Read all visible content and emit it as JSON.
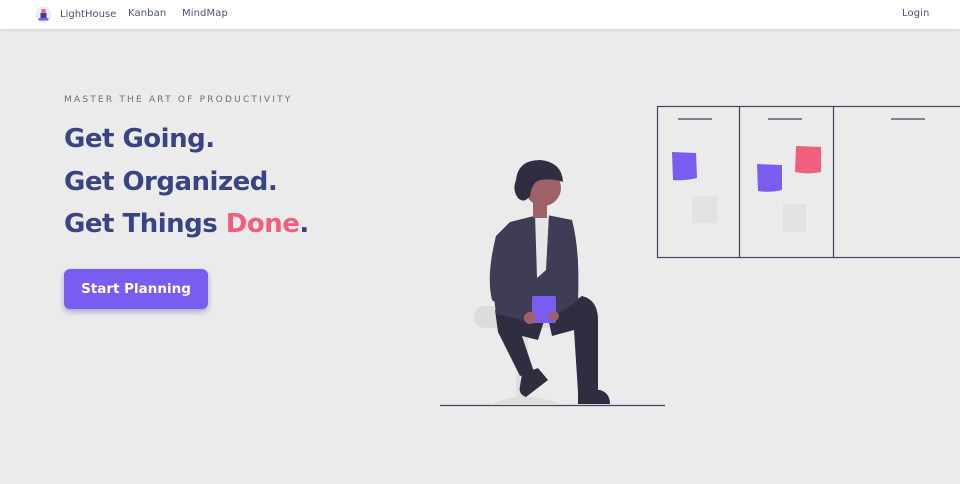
{
  "nav": {
    "brand": "LightHouse",
    "links": [
      "Kanban",
      "MindMap"
    ],
    "login": "Login"
  },
  "hero": {
    "eyebrow": "MASTER THE ART OF PRODUCTIVITY",
    "line1": "Get Going.",
    "line2": "Get Organized.",
    "line3_start": "Get Things ",
    "line3_accent": "Done",
    "line3_end": ".",
    "cta": "Start Planning"
  },
  "colors": {
    "background": "#ebebeb",
    "heading": "#3a4383",
    "accent": "#f0607c",
    "button": "#7b5cf0",
    "sticky_purple": "#7b5cf0",
    "sticky_pink": "#f0607c"
  },
  "illustration": {
    "icon": "person-sitting-kanban-board-illustration"
  }
}
